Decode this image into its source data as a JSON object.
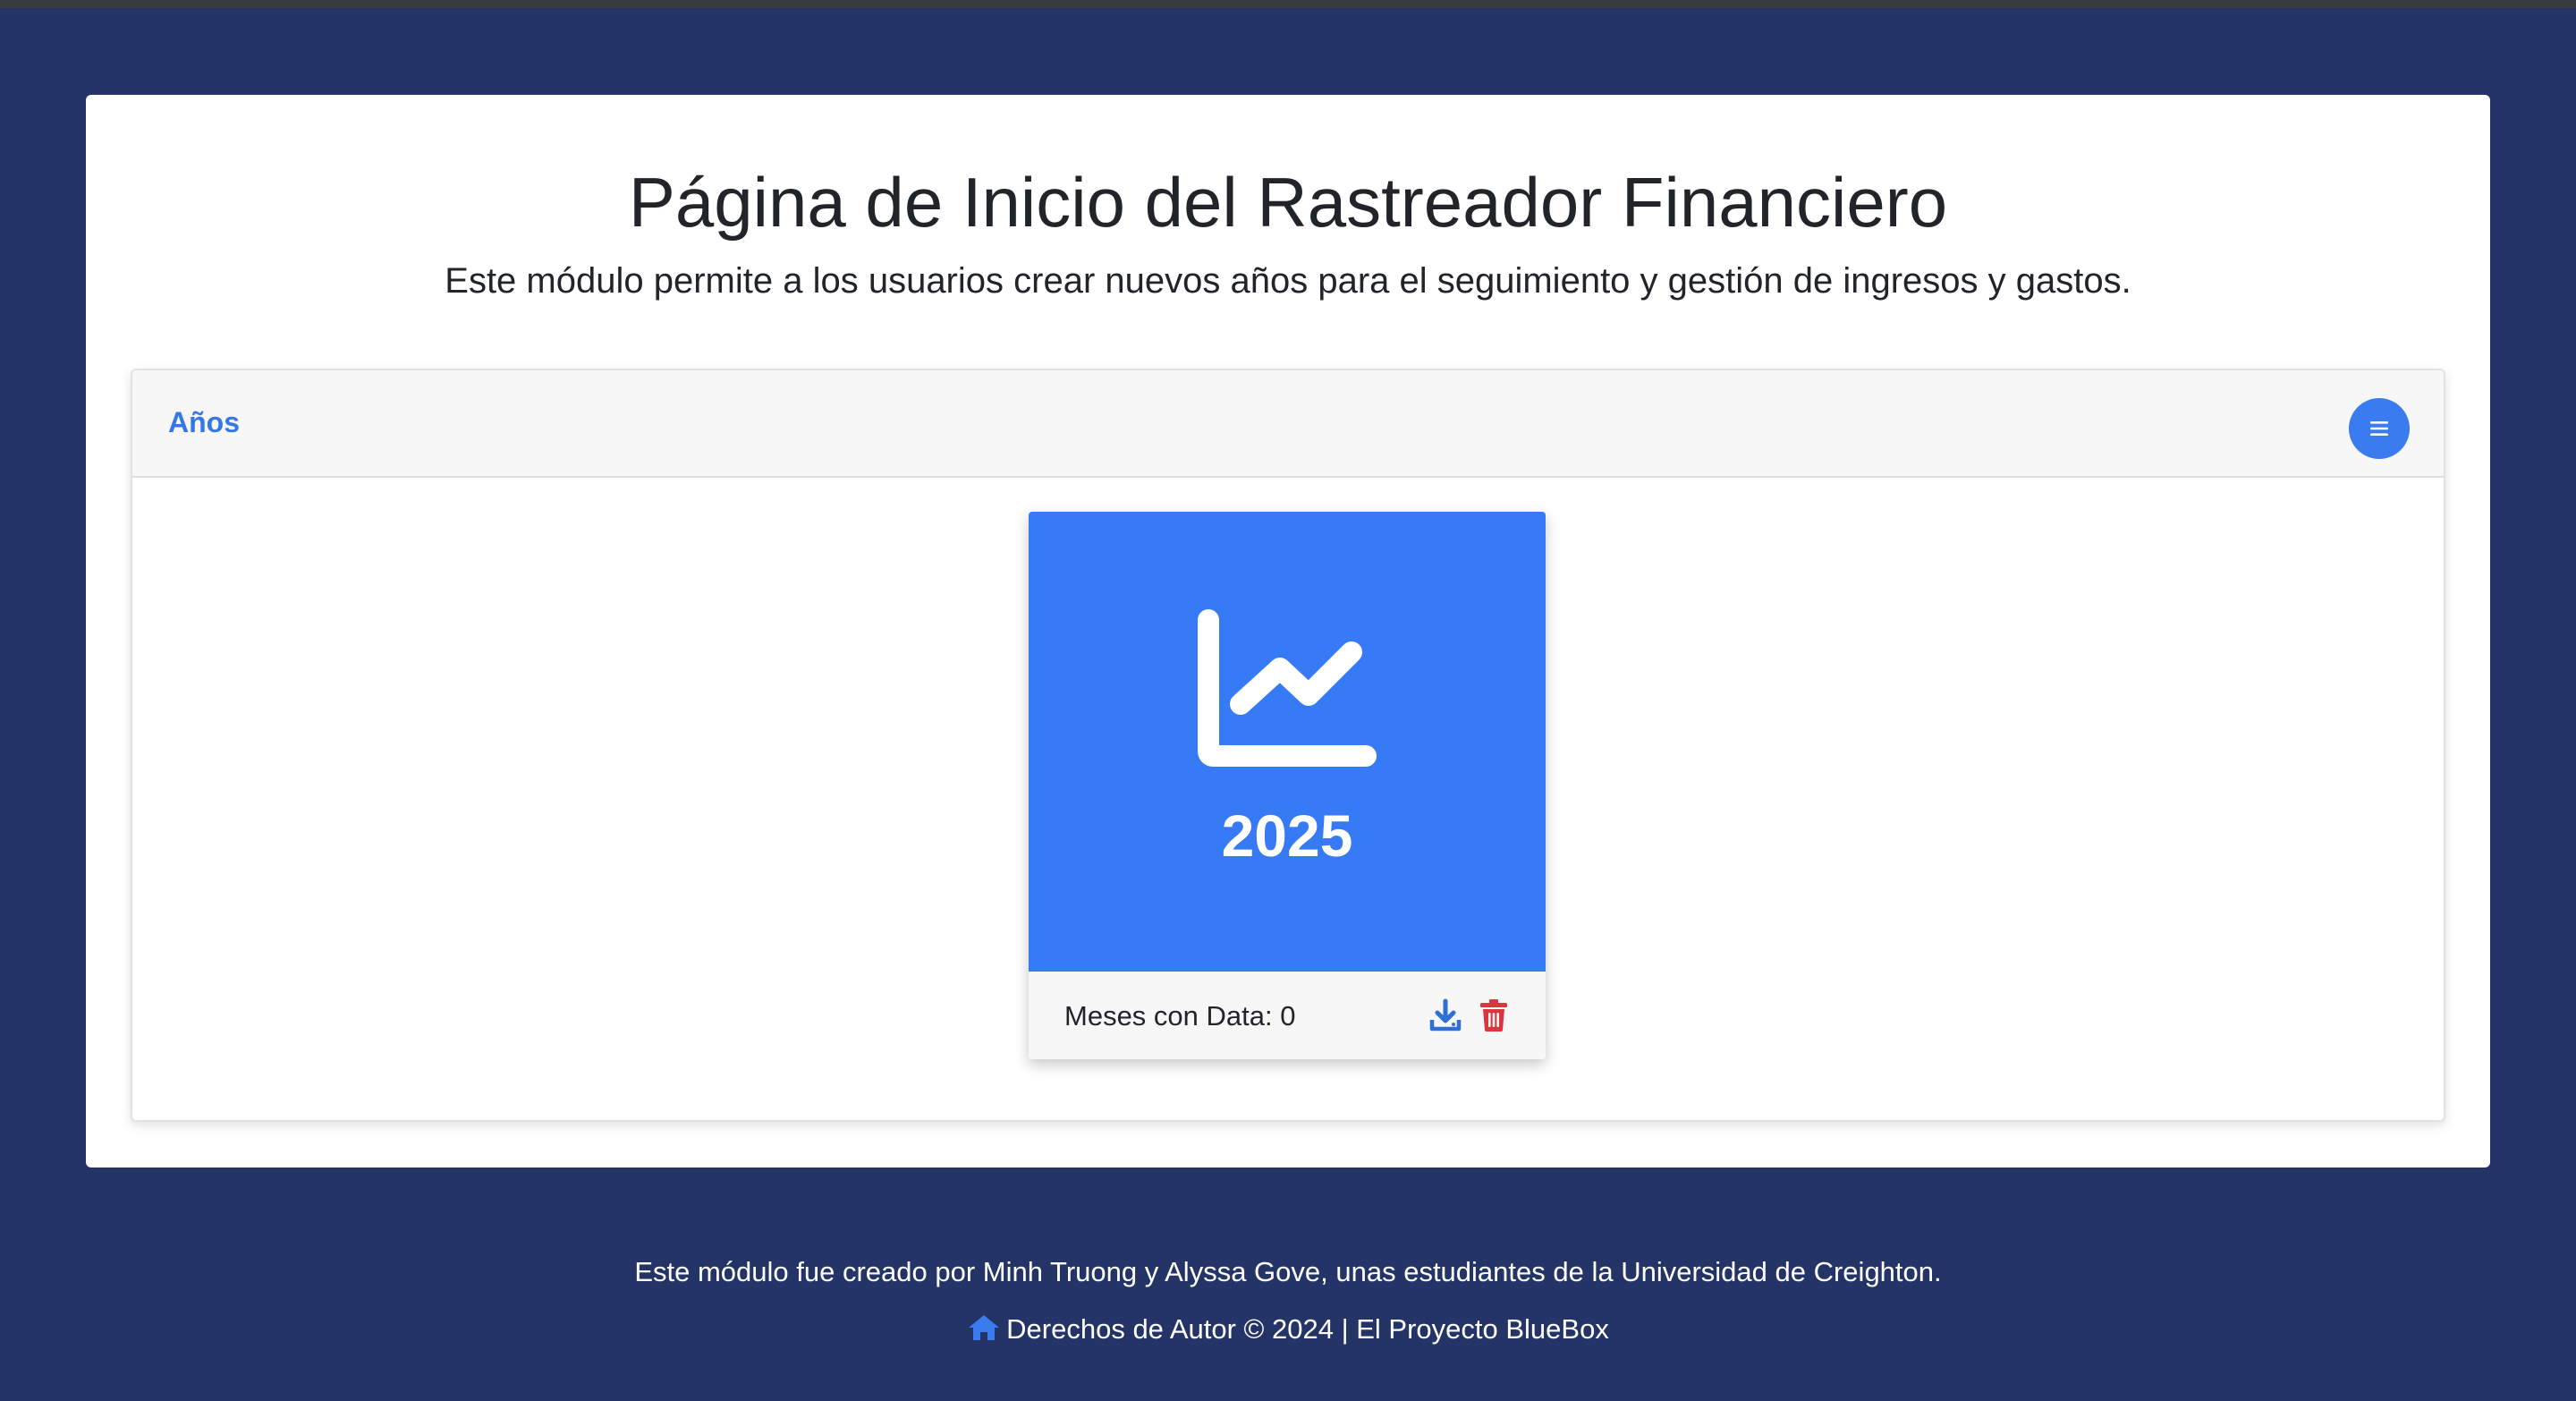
{
  "page": {
    "title": "Página de Inicio del Rastreador Financiero",
    "subtitle": "Este módulo permite a los usuarios crear nuevos años para el seguimiento y gestión de ingresos y gastos."
  },
  "panel": {
    "title": "Años",
    "menu_icon": "menu-lines-icon"
  },
  "years": [
    {
      "year": "2025",
      "icon": "line-chart-icon",
      "months_label": "Meses con Data: 0",
      "actions": [
        "download-icon",
        "trash-icon"
      ]
    }
  ],
  "footer": {
    "credit": "Este módulo fue creado por Minh Truong y Alyssa Gove, unas estudiantes de la Universidad de Creighton.",
    "copyright": "Derechos de Autor © 2024 | El Proyecto BlueBox",
    "home_icon": "home-icon"
  },
  "colors": {
    "background": "#243466",
    "accent": "#367af6",
    "danger": "#d9363e",
    "card_bg": "#ffffff"
  }
}
